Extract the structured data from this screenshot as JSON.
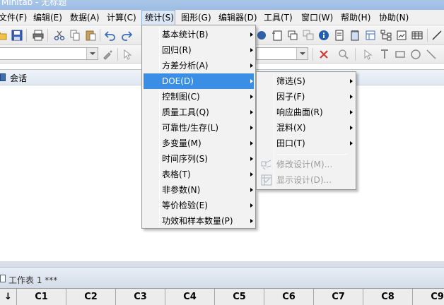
{
  "window": {
    "title": "Minitab - 无标题"
  },
  "menubar": [
    {
      "label": "文件(F)"
    },
    {
      "label": "编辑(E)"
    },
    {
      "label": "数据(A)"
    },
    {
      "label": "计算(C)"
    },
    {
      "label": "统计(S)"
    },
    {
      "label": "图形(G)"
    },
    {
      "label": "编辑器(D)"
    },
    {
      "label": "工具(T)"
    },
    {
      "label": "窗口(W)"
    },
    {
      "label": "帮助(H)"
    },
    {
      "label": "协助(N)"
    }
  ],
  "stat_menu": {
    "items": [
      {
        "label": "基本统计(B)",
        "submenu": true
      },
      {
        "label": "回归(R)",
        "submenu": true
      },
      {
        "label": "方差分析(A)",
        "submenu": true
      },
      {
        "label": "DOE(D)",
        "submenu": true,
        "highlighted": true
      },
      {
        "label": "控制图(C)",
        "submenu": true
      },
      {
        "label": "质量工具(Q)",
        "submenu": true
      },
      {
        "label": "可靠性/生存(L)",
        "submenu": true
      },
      {
        "label": "多变量(M)",
        "submenu": true
      },
      {
        "label": "时间序列(S)",
        "submenu": true
      },
      {
        "label": "表格(T)",
        "submenu": true
      },
      {
        "label": "非参数(N)",
        "submenu": true
      },
      {
        "label": "等价检验(E)",
        "submenu": true
      },
      {
        "label": "功效和样本数量(P)",
        "submenu": true
      }
    ]
  },
  "doe_menu": {
    "items": [
      {
        "label": "筛选(S)",
        "submenu": true
      },
      {
        "label": "因子(F)",
        "submenu": true
      },
      {
        "label": "响应曲面(R)",
        "submenu": true
      },
      {
        "label": "混料(X)",
        "submenu": true
      },
      {
        "label": "田口(T)",
        "submenu": true
      }
    ],
    "disabled_items": [
      {
        "label": "修改设计(M)...",
        "icon": "modify-design-icon"
      },
      {
        "label": "显示设计(D)...",
        "icon": "display-design-icon"
      }
    ]
  },
  "session": {
    "title": "会话"
  },
  "worksheet": {
    "title": "工作表 1 ***",
    "row_marker": "↓",
    "columns": [
      "C1",
      "C2",
      "C3",
      "C4",
      "C5",
      "C6",
      "C7",
      "C8",
      "C9"
    ]
  },
  "colors": {
    "highlight": "#3a8ee6",
    "menu_bg": "#f2f2f2"
  }
}
